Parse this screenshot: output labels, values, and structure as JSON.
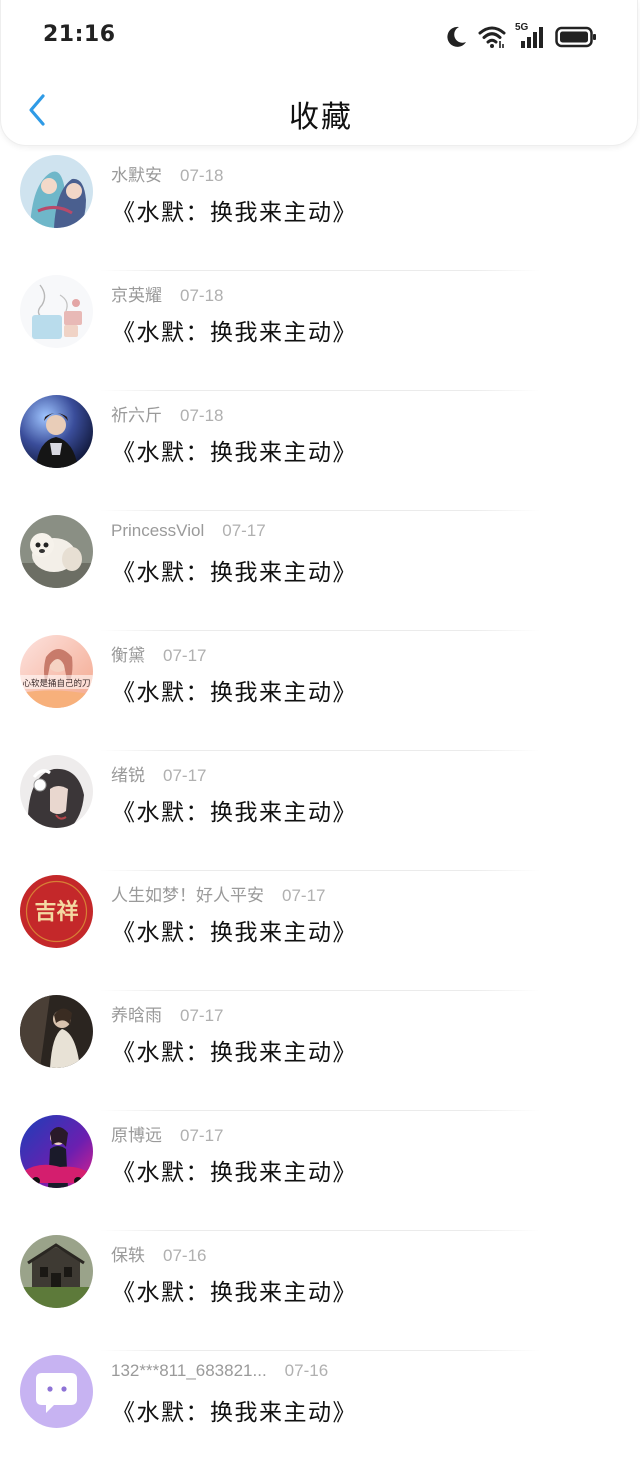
{
  "status_bar": {
    "time": "21:16",
    "network_label": "5G",
    "icons": [
      "moon-icon",
      "wifi-icon",
      "cellular-signal-icon",
      "battery-icon"
    ]
  },
  "header": {
    "back_icon": "chevron-left-icon",
    "title": "收藏"
  },
  "colors": {
    "accent": "#2f9be6",
    "title_text": "#111111",
    "meta_text": "#9a9a9a",
    "divider": "#ebebeb"
  },
  "items": [
    {
      "name": "水默安",
      "date": "07-18",
      "title": "《水默：换我来主动》",
      "avatar": "anime-couple-avatar"
    },
    {
      "name": "京英耀",
      "date": "07-18",
      "title": "《水默：换我来主动》",
      "avatar": "sketch-illustration-avatar"
    },
    {
      "name": "祈六斤",
      "date": "07-18",
      "title": "《水默：换我来主动》",
      "avatar": "singer-stage-avatar"
    },
    {
      "name": "PrincessViol",
      "date": "07-17",
      "title": "《水默：换我来主动》",
      "avatar": "white-dog-avatar"
    },
    {
      "name": "衡黛",
      "date": "07-17",
      "title": "《水默：换我来主动》",
      "avatar": "pink-girl-avatar",
      "avatar_text": "心软是捅自己的刀"
    },
    {
      "name": "绪锐",
      "date": "07-17",
      "title": "《水默：换我来主动》",
      "avatar": "anime-headphones-avatar"
    },
    {
      "name": "人生如梦！好人平安",
      "date": "07-17",
      "title": "《水默：换我来主动》",
      "avatar": "jixiang-red-avatar",
      "avatar_text": "吉祥"
    },
    {
      "name": "养晗雨",
      "date": "07-17",
      "title": "《水默：换我来主动》",
      "avatar": "dark-portrait-avatar"
    },
    {
      "name": "原博远",
      "date": "07-17",
      "title": "《水默：换我来主动》",
      "avatar": "neon-car-avatar"
    },
    {
      "name": "保轶",
      "date": "07-16",
      "title": "《水默：换我来主动》",
      "avatar": "old-house-avatar"
    },
    {
      "name": "132***811_683821...",
      "date": "07-16",
      "title": "《水默：换我来主动》",
      "avatar": "chat-bubble-default-avatar"
    }
  ]
}
